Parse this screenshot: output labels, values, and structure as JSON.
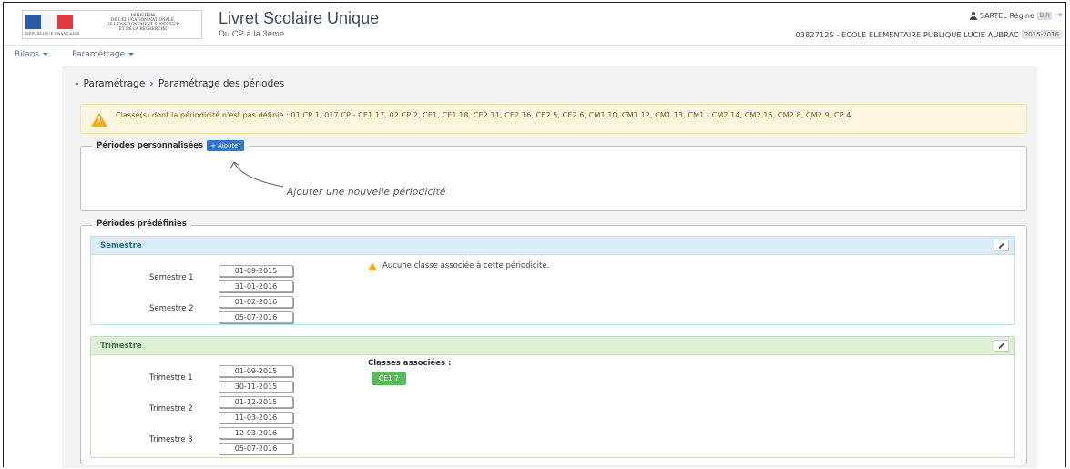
{
  "header": {
    "ministry_lines": [
      "Ministère",
      "de l'Éducation nationale,",
      "de l'Enseignement supérieur",
      "et de la Recherche"
    ],
    "republique": "RÉPUBLIQUE FRANÇAISE",
    "app_title": "Livret Scolaire Unique",
    "app_subtitle": "Du CP à la 3ème",
    "user_name": "SARTEL Régine",
    "user_badge": "DIR",
    "school": "0382712S - ECOLE ELEMENTAIRE PUBLIQUE LUCIE AUBRAC",
    "year": "2015-2016"
  },
  "nav": {
    "bilans": "Bilans",
    "parametrage": "Paramétrage"
  },
  "breadcrumb": {
    "level1": "Paramétrage",
    "level2": "Paramétrage des périodes"
  },
  "alert": {
    "text": "Classe(s) dont la périodicité n'est pas définie : 01 CP 1, 017 CP - CE1 17, 02 CP 2, CE1, CE1 18, CE2 11, CE2 16, CE2 5, CE2 6, CM1 10, CM1 12, CM1 13, CM1 - CM2 14, CM2 15, CM2 8, CM2 9, CP 4"
  },
  "custom": {
    "legend": "Périodes personnalisées",
    "add_button": "Ajouter",
    "hint": "Ajouter une nouvelle périodicité"
  },
  "predefined": {
    "legend": "Périodes prédéfinies",
    "semestre": {
      "title": "Semestre",
      "warning": "Aucune classe associée à cette périodicité.",
      "periods": [
        {
          "label": "Semestre 1",
          "start": "01-09-2015",
          "end": "31-01-2016"
        },
        {
          "label": "Semestre 2",
          "start": "01-02-2016",
          "end": "05-07-2016"
        }
      ]
    },
    "trimestre": {
      "title": "Trimestre",
      "classes_label": "Classes associées :",
      "classes": [
        "CE1 7"
      ],
      "periods": [
        {
          "label": "Trimestre 1",
          "start": "01-09-2015",
          "end": "30-11-2015"
        },
        {
          "label": "Trimestre 2",
          "start": "01-12-2015",
          "end": "11-03-2016"
        },
        {
          "label": "Trimestre 3",
          "start": "12-03-2016",
          "end": "05-07-2016"
        }
      ]
    }
  },
  "colors": {
    "primary": "#3277c3",
    "warning": "#f0ad2c",
    "success": "#5cb85c",
    "info_bg": "#d9edf7",
    "success_bg": "#dff0d8"
  }
}
